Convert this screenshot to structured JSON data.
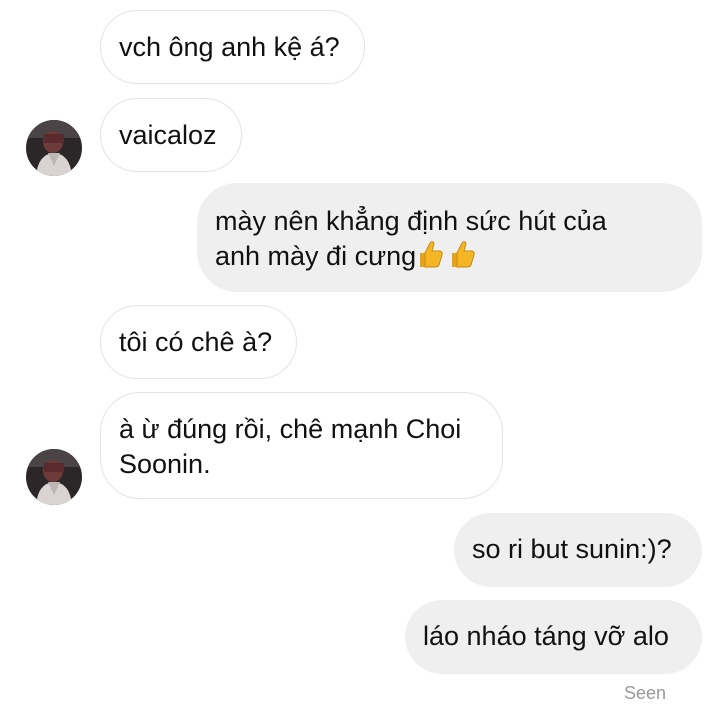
{
  "messages": [
    {
      "direction": "incoming",
      "text": "vch ông anh kệ á?"
    },
    {
      "direction": "incoming",
      "text": "vaicaloz",
      "avatar": "profile-photo"
    },
    {
      "direction": "outgoing",
      "lines": [
        "mày nên khẳng định sức hút của",
        "anh mày đi cưng"
      ],
      "emoji": [
        "thumbs-up-icon",
        "thumbs-up-icon"
      ]
    },
    {
      "direction": "incoming",
      "text": "tôi có chê à?"
    },
    {
      "direction": "incoming",
      "lines": [
        "à ừ đúng rồi, chê mạnh Choi",
        "Soonin."
      ],
      "avatar": "profile-photo"
    },
    {
      "direction": "outgoing",
      "text": "so ri but sunin:)?"
    },
    {
      "direction": "outgoing",
      "text": "láo nháo táng vỡ alo"
    }
  ],
  "status": {
    "seen_label": "Seen"
  },
  "colors": {
    "outgoing_bubble": "#efefef",
    "incoming_border": "#e3e3e3",
    "text": "#111111",
    "seen_text": "#9a9a9a",
    "thumbs_up": "#f4b624"
  }
}
